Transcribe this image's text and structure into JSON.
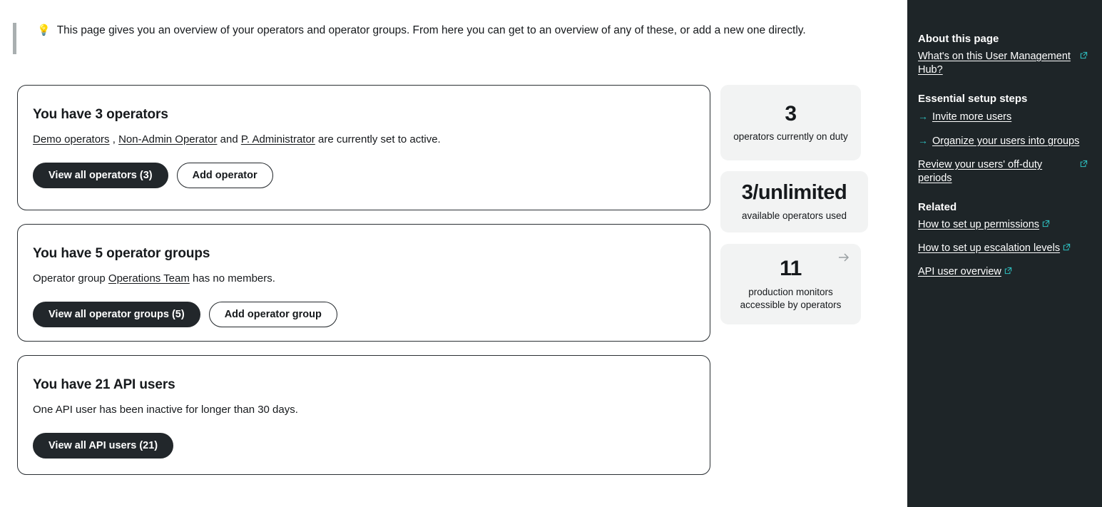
{
  "banner": {
    "icon": "lightbulb-icon",
    "text": "This page gives you an overview of your operators and operator groups. From here you can get to an overview of any of these, or add a new one directly."
  },
  "cards": [
    {
      "id": "operators",
      "title": "You have 3 operators",
      "desc_link_1": "Demo operators",
      "desc_sep_1": " , ",
      "desc_link_2": "Non-Admin Operator",
      "desc_sep_2": " and ",
      "desc_link_3": "P. Administrator",
      "desc_tail": " are currently set to active.",
      "primary_button": "View all operators (3)",
      "secondary_button": "Add operator"
    },
    {
      "id": "operator-groups",
      "title": "You have 5 operator groups",
      "desc_head": "Operator group ",
      "desc_link_1": "Operations Team",
      "desc_tail": " has no members.",
      "primary_button": "View all operator groups (5)",
      "secondary_button": "Add operator group"
    },
    {
      "id": "api-users",
      "title": "You have 21 API users",
      "desc_tail": "One API user has been inactive for longer than 30 days.",
      "primary_button": "View all API users (21)"
    }
  ],
  "stats": [
    {
      "id": "on-duty",
      "value": "3",
      "label": "operators currently on duty",
      "arrow": false
    },
    {
      "id": "available",
      "value": "3/unlimited",
      "label": "available operators used",
      "arrow": false
    },
    {
      "id": "monitors",
      "value": "11",
      "label": "production monitors accessible by operators",
      "arrow": true,
      "arrow_icon": "arrow-right-icon"
    }
  ],
  "sidebar": {
    "about": {
      "heading": "About this page",
      "link": "What's on this User Management Hub?"
    },
    "essential": {
      "heading": "Essential setup steps",
      "items": [
        {
          "label": "Invite more users",
          "arrow": "→",
          "external": false
        },
        {
          "label": "Organize your users into groups",
          "arrow": "→",
          "external": false
        },
        {
          "label": "Review your users' off-duty periods",
          "arrow": "",
          "external": true
        }
      ]
    },
    "related": {
      "heading": "Related",
      "items": [
        {
          "label": "How to set up permissions",
          "external": true
        },
        {
          "label": "How to set up escalation levels",
          "external": true
        },
        {
          "label": "API user overview",
          "external": true
        }
      ]
    }
  },
  "colors": {
    "sidebar_bg": "#1e2528",
    "accent_teal": "#2ebfc0",
    "primary_button_bg": "#22272b",
    "stat_tile_bg": "#f2f3f3",
    "banner_rule": "#a9afb0"
  }
}
